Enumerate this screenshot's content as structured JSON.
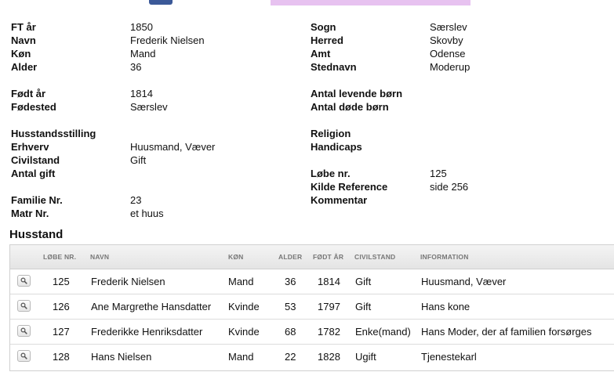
{
  "info_left": [
    {
      "label": "FT år",
      "value": "1850"
    },
    {
      "label": "Navn",
      "value": "Frederik Nielsen"
    },
    {
      "label": "Køn",
      "value": "Mand"
    },
    {
      "label": "Alder",
      "value": "36"
    },
    {
      "label": "",
      "value": ""
    },
    {
      "label": "Født år",
      "value": "1814"
    },
    {
      "label": "Fødested",
      "value": "Særslev"
    },
    {
      "label": "",
      "value": ""
    },
    {
      "label": "Husstandsstilling",
      "value": ""
    },
    {
      "label": "Erhverv",
      "value": "Huusmand, Væver"
    },
    {
      "label": "Civilstand",
      "value": "Gift"
    },
    {
      "label": "Antal gift",
      "value": ""
    },
    {
      "label": "",
      "value": ""
    },
    {
      "label": "Familie Nr.",
      "value": "23"
    },
    {
      "label": "Matr Nr.",
      "value": "et huus"
    }
  ],
  "info_right": [
    {
      "label": "Sogn",
      "value": "Særslev"
    },
    {
      "label": "Herred",
      "value": "Skovby"
    },
    {
      "label": "Amt",
      "value": "Odense"
    },
    {
      "label": "Stednavn",
      "value": "Moderup"
    },
    {
      "label": "",
      "value": ""
    },
    {
      "label": "Antal levende børn",
      "value": ""
    },
    {
      "label": "Antal døde børn",
      "value": ""
    },
    {
      "label": "",
      "value": ""
    },
    {
      "label": "Religion",
      "value": ""
    },
    {
      "label": "Handicaps",
      "value": ""
    },
    {
      "label": "",
      "value": ""
    },
    {
      "label": "Løbe nr.",
      "value": "125"
    },
    {
      "label": "Kilde Reference",
      "value": "side 256"
    },
    {
      "label": "Kommentar",
      "value": ""
    }
  ],
  "household": {
    "title": "Husstand",
    "columns": [
      "LØBE NR.",
      "NAVN",
      "KØN",
      "ALDER",
      "FØDT ÅR",
      "CIVILSTAND",
      "INFORMATION"
    ],
    "rows": [
      {
        "lobe_nr": "125",
        "navn": "Frederik Nielsen",
        "kon": "Mand",
        "alder": "36",
        "fodt_ar": "1814",
        "civilstand": "Gift",
        "information": "Huusmand, Væver"
      },
      {
        "lobe_nr": "126",
        "navn": "Ane Margrethe Hansdatter",
        "kon": "Kvinde",
        "alder": "53",
        "fodt_ar": "1797",
        "civilstand": "Gift",
        "information": "Hans kone"
      },
      {
        "lobe_nr": "127",
        "navn": "Frederikke Henriksdatter",
        "kon": "Kvinde",
        "alder": "68",
        "fodt_ar": "1782",
        "civilstand": "Enke(mand)",
        "information": "Hans Moder, der af familien forsørges"
      },
      {
        "lobe_nr": "128",
        "navn": "Hans Nielsen",
        "kon": "Mand",
        "alder": "22",
        "fodt_ar": "1828",
        "civilstand": "Ugift",
        "information": "Tjenestekarl"
      }
    ]
  }
}
